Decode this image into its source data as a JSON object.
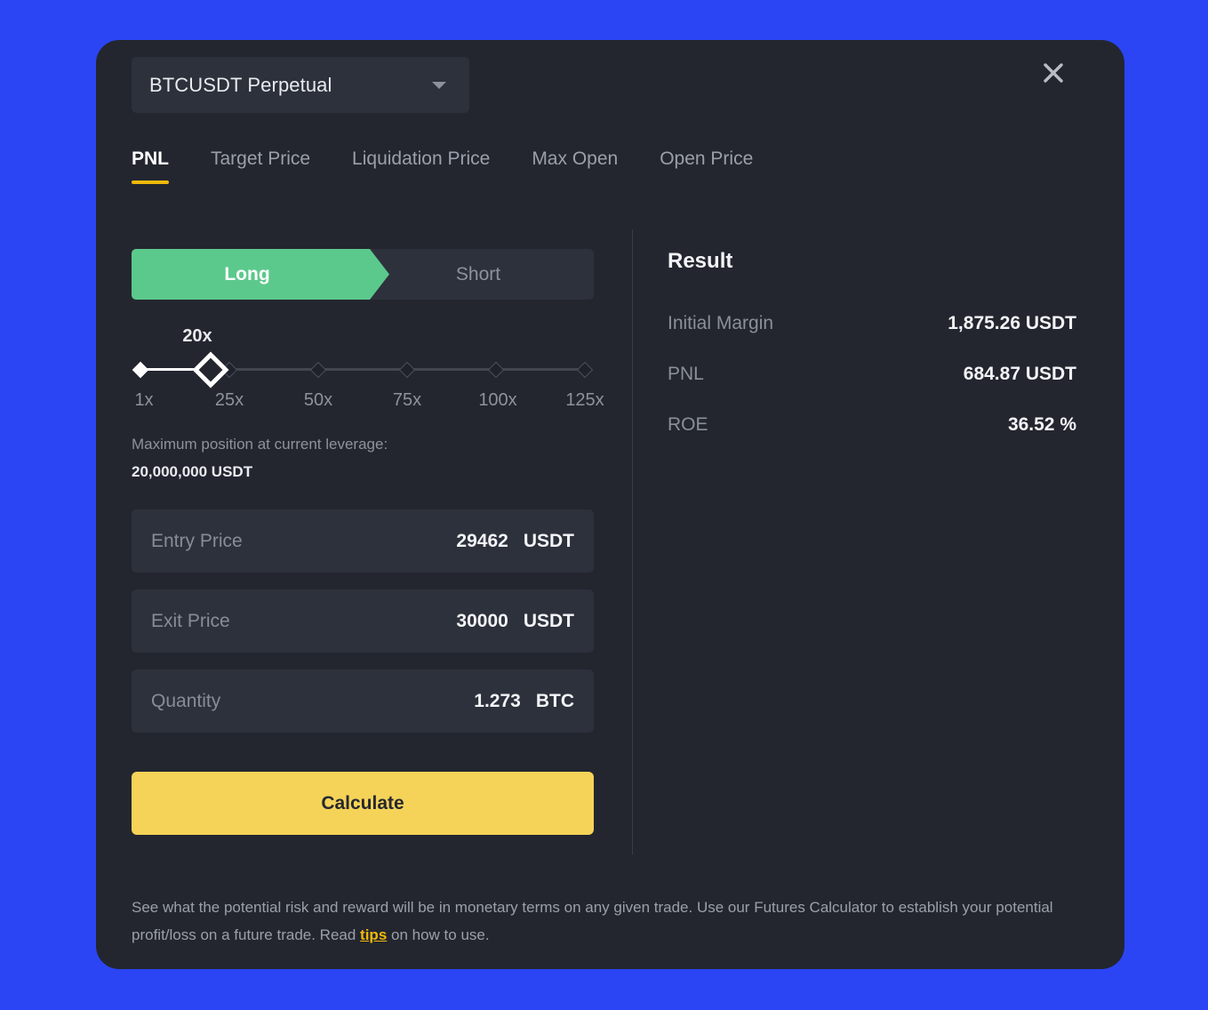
{
  "window": {
    "background_color": "#2b45f4",
    "modal_background": "#23262f"
  },
  "header": {
    "symbol": "BTCUSDT Perpetual",
    "caret_icon": "chevron-down-icon",
    "close_icon": "close-icon"
  },
  "tabs": [
    {
      "label": "PNL",
      "active": true
    },
    {
      "label": "Target Price",
      "active": false
    },
    {
      "label": "Liquidation Price",
      "active": false
    },
    {
      "label": "Max Open",
      "active": false
    },
    {
      "label": "Open Price",
      "active": false
    }
  ],
  "side_toggle": {
    "long_label": "Long",
    "short_label": "Short",
    "selected": "Long",
    "long_color": "#5cc98c"
  },
  "leverage": {
    "current": "20x",
    "scale": [
      "1x",
      "25x",
      "50x",
      "75x",
      "100x",
      "125x"
    ],
    "max_position_label": "Maximum position at current leverage:",
    "max_position_value": "20,000,000 USDT"
  },
  "fields": [
    {
      "label": "Entry Price",
      "value": "29462",
      "unit": "USDT"
    },
    {
      "label": "Exit Price",
      "value": "30000",
      "unit": "USDT"
    },
    {
      "label": "Quantity",
      "value": "1.273",
      "unit": "BTC"
    }
  ],
  "calculate": {
    "label": "Calculate",
    "color": "#f5d358"
  },
  "result": {
    "title": "Result",
    "rows": [
      {
        "key": "Initial Margin",
        "value": "1,875.26 USDT"
      },
      {
        "key": "PNL",
        "value": "684.87 USDT"
      },
      {
        "key": "ROE",
        "value": "36.52 %"
      }
    ]
  },
  "footer": {
    "part1": "See what the potential risk and reward will be in monetary terms on any given trade. Use our Futures Calculator to establish your potential profit/loss on a future trade. Read ",
    "link": "tips",
    "part2": " on how to use."
  }
}
